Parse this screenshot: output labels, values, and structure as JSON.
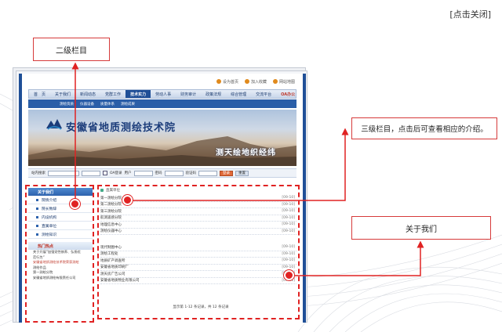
{
  "close_label": "[点击关闭]",
  "callouts": {
    "level2": "二级栏目",
    "level3": "三级栏目，点击后可查看相应的介绍。",
    "about": "关于我们"
  },
  "site": {
    "topbar": [
      "设为首页",
      "加入收藏",
      "网站地图"
    ],
    "nav": [
      "首　页",
      "关于我们",
      "新闻动态",
      "党群工作",
      "技术实力",
      "劳动人事",
      "财务审计",
      "政策法规",
      "综合管理",
      "交流平台",
      "OA办公"
    ],
    "nav_active_index": 4,
    "subnav": [
      "测绘资质",
      "仪器设备",
      "质量体系",
      "测绘成果"
    ],
    "banner_title": "安徽省地质测绘技术院",
    "banner_slogan": "测天绘地织经纬",
    "search": {
      "label": "站内搜索",
      "oa_label": "OA登录",
      "user_label": "用户",
      "password_label": "密码",
      "captcha_label": "验证码",
      "login_button": "登录",
      "reset_button": "重置"
    },
    "sidebar": {
      "head": "关于我们",
      "items": [
        "院情介绍",
        "院长致辞",
        "内设机构",
        "直属单位",
        "测绘知识"
      ],
      "hot_head": "热门热点",
      "hot_items": [
        {
          "text": "关于开展“加强党性修养、弘扬优",
          "red": false
        },
        {
          "text": "范行为”",
          "red": false
        },
        {
          "text": "安徽省地质测绘技术院荣获测绘",
          "red": true
        },
        {
          "text": "测绘作品",
          "red": false
        },
        {
          "text": "第一测绘分院",
          "red": false
        },
        {
          "text": "安徽省地质测绘有限责任公司",
          "red": false
        }
      ]
    },
    "content": {
      "crumb": "直属单位",
      "group1": [
        {
          "name": "第一测绘分院",
          "date": "[09-10]"
        },
        {
          "name": "第二测绘分院",
          "date": "[09-10]"
        },
        {
          "name": "第三测绘分院",
          "date": "[09-10]"
        },
        {
          "name": "航测遥感分院",
          "date": "[09-10]"
        },
        {
          "name": "地理信息中心",
          "date": "[09-10]"
        },
        {
          "name": "测绘仪器中心",
          "date": "[09-10]"
        }
      ],
      "group2": [
        {
          "name": "现代制图中心",
          "date": "[09-10]"
        },
        {
          "name": "测绘工程处",
          "date": "[09-10]"
        },
        {
          "name": "地质矿产调查所",
          "date": "[09-10]"
        },
        {
          "name": "安徽省地质印刷厂",
          "date": "[09-10]"
        },
        {
          "name": "测天房广告公司",
          "date": "[09-10]"
        },
        {
          "name": "安徽省地质物业有限公司",
          "date": "[09-11]"
        }
      ],
      "pager": "显示第 1-12 条记录，共 12 条记录"
    }
  },
  "colors": {
    "accent_red": "#e02222",
    "nav_blue": "#1f4f97"
  }
}
